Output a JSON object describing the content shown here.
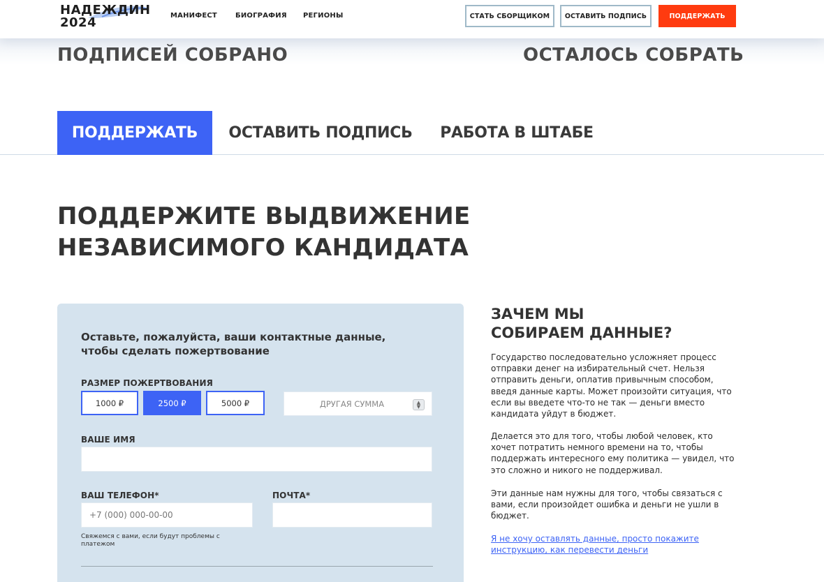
{
  "header": {
    "logo_line1": "НАДЕЖДИН",
    "logo_line2": "2024",
    "nav": [
      "МАНИФЕСТ",
      "БИОГРАФИЯ",
      "РЕГИОНЫ"
    ],
    "btn_collector": "СТАТЬ СБОРЩИКОМ",
    "btn_sign": "ОСТАВИТЬ ПОДПИСЬ",
    "btn_support": "ПОДДЕРЖАТЬ"
  },
  "counters": {
    "collected_label": "ПОДПИСЕЙ СОБРАНО",
    "remaining_label": "ОСТАЛОСЬ СОБРАТЬ"
  },
  "tabs": [
    "ПОДДЕРЖАТЬ",
    "ОСТАВИТЬ ПОДПИСЬ",
    "РАБОТА В ШТАБЕ"
  ],
  "section": {
    "title_line1": "ПОДДЕРЖИТЕ ВЫДВИЖЕНИЕ",
    "title_line2": "НЕЗАВИСИМОГО КАНДИДАТА"
  },
  "form": {
    "intro_line1": "Оставьте, пожалуйста, ваши контактные данные,",
    "intro_line2": "чтобы сделать пожертвование",
    "amount_label": "РАЗМЕР ПОЖЕРТВОВАНИЯ",
    "amounts": [
      "1000 ₽",
      "2500 ₽",
      "5000 ₽"
    ],
    "selected_amount": "2500 ₽",
    "other_placeholder": "ДРУГАЯ СУММА",
    "name_label": "ВАШЕ ИМЯ",
    "name_value": "",
    "phone_label": "ВАШ ТЕЛЕФОН*",
    "phone_placeholder": "+7 (000) 000-00-00",
    "email_label": "ПОЧТА*",
    "email_value": "",
    "phone_hint": "Свяжемся с вами, если будут проблемы с платежом"
  },
  "why": {
    "title_line1": "ЗАЧЕМ МЫ",
    "title_line2": "СОБИРАЕМ ДАННЫЕ?",
    "p1": "Государство последовательно усложняет процесс отправки денег на избирательный счет. Нельзя отправить деньги, оплатив привычным способом, введя данные карты. Может произойти ситуация, что если вы введете что-то не так — деньги вместо кандидата уйдут в бюджет.",
    "p2": "Делается это для того, чтобы любой человек, кто хочет потратить немного времени на то, чтобы поддержать интересного ему политика — увидел, что это сложно и никого не поддерживал.",
    "p3": "Эти данные нам нужны для того, чтобы связаться с вами, если произойдет ошибка и деньги не ушли в бюджет.",
    "link": "Я не хочу оставлять данные, просто покажите инструкцию, как перевести деньги"
  },
  "colors": {
    "accent_blue": "#3d63f5",
    "accent_red": "#ff3b0f",
    "card_bg": "#d5e3ee"
  }
}
